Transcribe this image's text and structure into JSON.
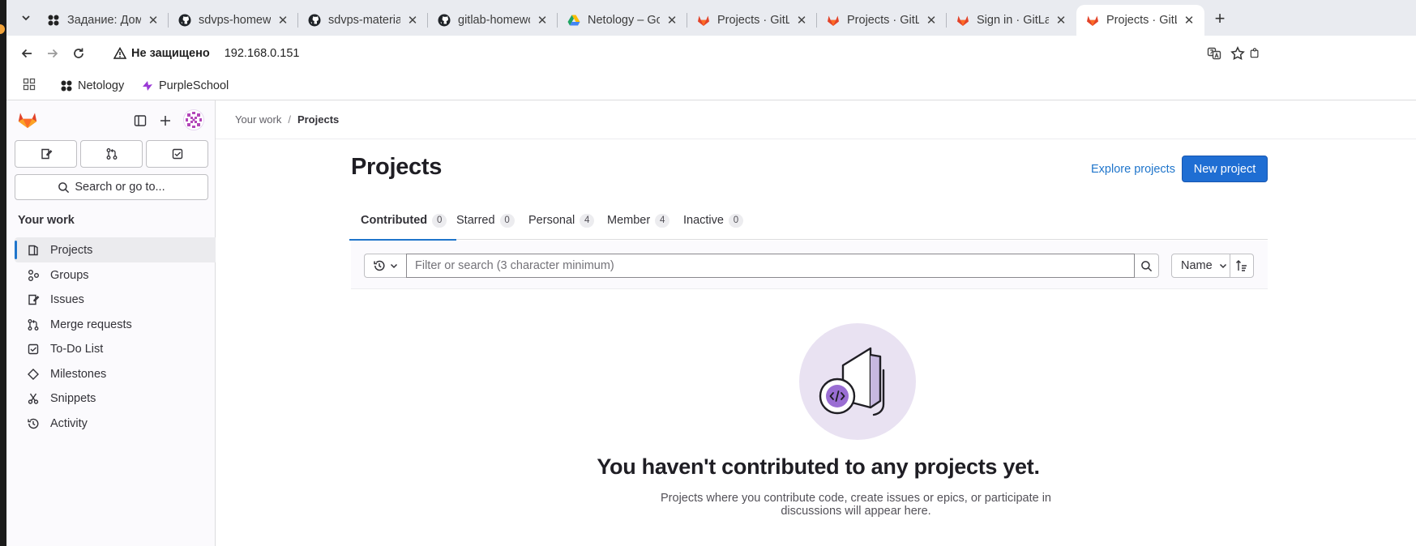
{
  "browser": {
    "tabs": [
      {
        "title": "Задание: Домаш",
        "icon": "netology-icon",
        "active": false
      },
      {
        "title": "sdvps-homewor",
        "icon": "github-icon",
        "active": false
      },
      {
        "title": "sdvps-materials/",
        "icon": "github-icon",
        "active": false
      },
      {
        "title": "gitlab-homewor",
        "icon": "github-icon",
        "active": false
      },
      {
        "title": "Netology – Goo",
        "icon": "google-drive-icon",
        "active": false
      },
      {
        "title": "Projects · GitLab",
        "icon": "gitlab-icon",
        "active": false
      },
      {
        "title": "Projects · GitLab",
        "icon": "gitlab-icon",
        "active": false
      },
      {
        "title": "Sign in · GitLab",
        "icon": "gitlab-icon",
        "active": false
      },
      {
        "title": "Projects · GitLab",
        "icon": "gitlab-icon",
        "active": true
      }
    ],
    "address": {
      "security_label": "Не защищено",
      "url": "192.168.0.151"
    },
    "bookmarks": [
      {
        "label": "Netology",
        "icon": "netology-icon"
      },
      {
        "label": "PurpleSchool",
        "icon": "purpleschool-icon"
      }
    ]
  },
  "sidebar": {
    "search_label": "Search or go to...",
    "section_title": "Your work",
    "items": [
      {
        "label": "Projects",
        "icon": "project-icon",
        "active": true
      },
      {
        "label": "Groups",
        "icon": "group-icon",
        "active": false
      },
      {
        "label": "Issues",
        "icon": "issues-icon",
        "active": false
      },
      {
        "label": "Merge requests",
        "icon": "merge-request-icon",
        "active": false
      },
      {
        "label": "To-Do List",
        "icon": "todo-icon",
        "active": false
      },
      {
        "label": "Milestones",
        "icon": "milestone-icon",
        "active": false
      },
      {
        "label": "Snippets",
        "icon": "snippet-icon",
        "active": false
      },
      {
        "label": "Activity",
        "icon": "history-icon",
        "active": false
      }
    ]
  },
  "breadcrumb": {
    "parent": "Your work",
    "separator": "/",
    "current": "Projects"
  },
  "page": {
    "title": "Projects",
    "explore_label": "Explore projects",
    "new_project_label": "New project"
  },
  "project_tabs": [
    {
      "label": "Contributed",
      "count": "0",
      "active": true
    },
    {
      "label": "Starred",
      "count": "0",
      "active": false
    },
    {
      "label": "Personal",
      "count": "4",
      "active": false
    },
    {
      "label": "Member",
      "count": "4",
      "active": false
    },
    {
      "label": "Inactive",
      "count": "0",
      "active": false
    }
  ],
  "filter": {
    "placeholder": "Filter or search (3 character minimum)",
    "sort_label": "Name"
  },
  "empty_state": {
    "title": "You haven't contributed to any projects yet.",
    "description": "Projects where you contribute code, create issues or epics, or participate in discussions will appear here."
  },
  "colors": {
    "primary_button": "#1f6ed3",
    "link": "#1f75cb",
    "active_indicator": "#1f75cb",
    "illustration_bg": "#e9e2f2",
    "gitlab_orange": "#e24329"
  }
}
